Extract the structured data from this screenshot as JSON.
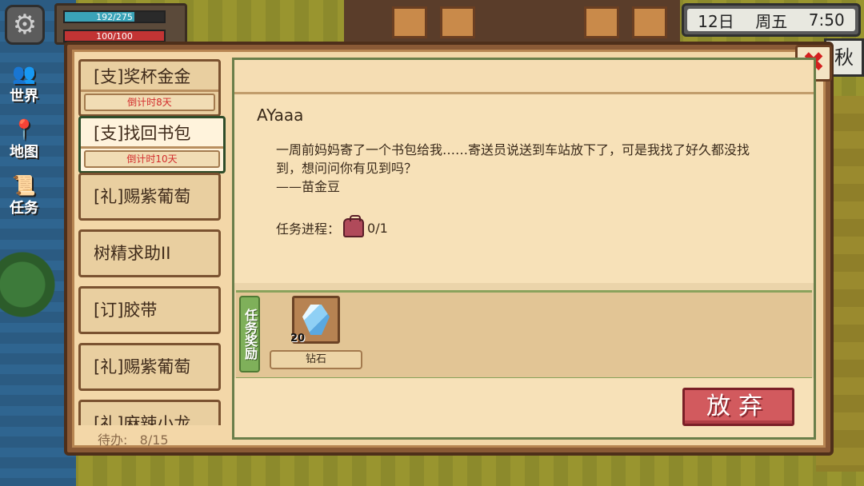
{
  "hud": {
    "energy": {
      "text": "192/275",
      "current": 192,
      "max": 275
    },
    "health": {
      "text": "100/100",
      "current": 100,
      "max": 100
    },
    "settings_icon": "gear-icon",
    "clock": {
      "day": "12日",
      "weekday": "周五",
      "time": "7:50"
    },
    "season": "秋",
    "nav": [
      {
        "label": "世界",
        "icon": "people-icon"
      },
      {
        "label": "地图",
        "icon": "map-pin-icon"
      },
      {
        "label": "任务",
        "icon": "quest-scroll-icon"
      }
    ]
  },
  "quests": [
    {
      "name": "[支]奖杯金金",
      "countdown": "倒计时8天"
    },
    {
      "name": "[支]找回书包",
      "countdown": "倒计时10天",
      "active": true
    },
    {
      "name": "[礼]赐紫葡萄"
    },
    {
      "name": "树精求助II"
    },
    {
      "name": "[订]胶带"
    },
    {
      "name": "[礼]赐紫葡萄"
    },
    {
      "name": "[礼]麻辣小龙"
    }
  ],
  "todo": {
    "label": "待办:",
    "value": "8/15"
  },
  "detail": {
    "sender": "AYaaa",
    "letter": [
      "一周前妈妈寄了一个书包给我……寄送员说送到车站放下了，可是我找了好久都没找",
      "到，想问问你有见到吗？",
      "——苗金豆"
    ],
    "progress_label": "任务进程：",
    "progress_icon": "schoolbag-icon",
    "progress_value": "0/1",
    "reward_tag": "任务奖励",
    "rewards": [
      {
        "name": "钻石",
        "qty": "20",
        "icon": "diamond-icon"
      }
    ],
    "abandon_label": "放弃"
  }
}
